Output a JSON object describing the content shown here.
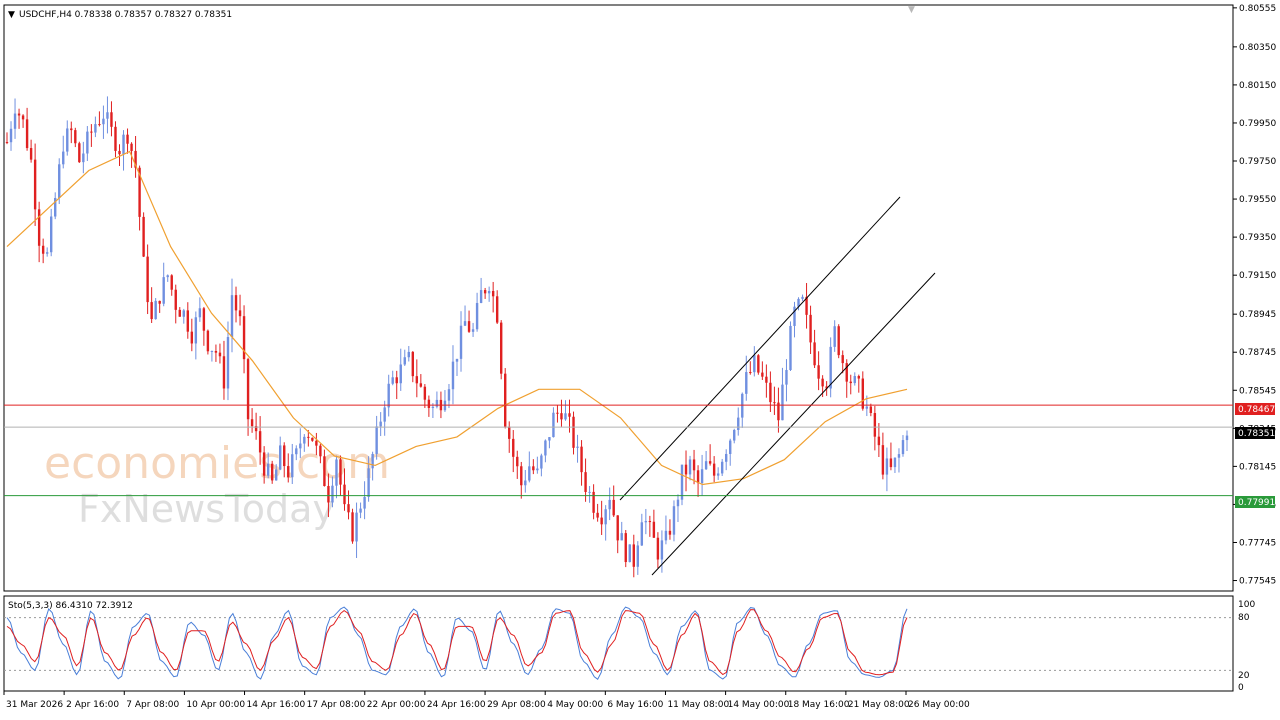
{
  "header": {
    "symbol_line": "USDCHF,H4  0.78338 0.78357 0.78327 0.78351"
  },
  "indicator": {
    "label": "Sto(5,3,3) 86.4310 72.3912",
    "levels": [
      "100",
      "80",
      "20",
      "0"
    ]
  },
  "watermark": {
    "line1": "economies.com",
    "line2": "FxNewsToday"
  },
  "price_labels": {
    "resistance": "0.78467",
    "current": "0.78351",
    "support": "0.77991"
  },
  "colors": {
    "bull": "#6f8fe0",
    "bear": "#e02020",
    "ma": "#f0a030",
    "resistance": "#e02020",
    "support": "#2a9a3a",
    "current_line": "#b0b0b0",
    "stoch_main": "#4a7fd8",
    "stoch_signal": "#e02020"
  },
  "chart_data": {
    "type": "candlestick",
    "instrument": "USDCHF",
    "timeframe": "H4",
    "ylim": [
      0.7749,
      0.8057
    ],
    "y_ticks": [
      "0.80555",
      "0.80350",
      "0.80150",
      "0.79950",
      "0.79750",
      "0.79550",
      "0.79350",
      "0.79150",
      "0.78945",
      "0.78745",
      "0.78545",
      "0.78345",
      "0.78145",
      "0.77945",
      "0.77745",
      "0.77545"
    ],
    "x_ticks": [
      "31 Mar 2026",
      "2 Apr 16:00",
      "7 Apr 08:00",
      "10 Apr 00:00",
      "14 Apr 16:00",
      "17 Apr 08:00",
      "22 Apr 00:00",
      "24 Apr 16:00",
      "29 Apr 08:00",
      "4 May 00:00",
      "6 May 16:00",
      "11 May 08:00",
      "14 May 00:00",
      "18 May 16:00",
      "21 May 08:00",
      "26 May 00:00"
    ],
    "series": [
      {
        "name": "price_path",
        "values": [
          0.7985,
          0.8005,
          0.7995,
          0.7975,
          0.7935,
          0.7925,
          0.7955,
          0.7985,
          0.799,
          0.7975,
          0.7985,
          0.7995,
          0.8,
          0.799,
          0.7982,
          0.799,
          0.7972,
          0.792,
          0.789,
          0.7905,
          0.7915,
          0.79,
          0.7895,
          0.7885,
          0.7895,
          0.788,
          0.7875,
          0.786,
          0.7905,
          0.789,
          0.784,
          0.783,
          0.7815,
          0.7805,
          0.782,
          0.7812,
          0.782,
          0.7835,
          0.783,
          0.7815,
          0.78,
          0.782,
          0.779,
          0.778,
          0.7795,
          0.781,
          0.783,
          0.785,
          0.786,
          0.7865,
          0.787,
          0.786,
          0.785,
          0.7845,
          0.785,
          0.786,
          0.7875,
          0.789,
          0.7885,
          0.7905,
          0.7912,
          0.7895,
          0.784,
          0.782,
          0.7805,
          0.7815,
          0.781,
          0.7825,
          0.784,
          0.7845,
          0.7835,
          0.782,
          0.7805,
          0.7795,
          0.779,
          0.78,
          0.778,
          0.777,
          0.7765,
          0.779,
          0.778,
          0.777,
          0.7775,
          0.779,
          0.781,
          0.7815,
          0.7805,
          0.7815,
          0.781,
          0.782,
          0.783,
          0.7845,
          0.786,
          0.7868,
          0.786,
          0.785,
          0.784,
          0.787,
          0.7895,
          0.79,
          0.788,
          0.7865,
          0.786,
          0.7885,
          0.787,
          0.786,
          0.7855,
          0.7845,
          0.783,
          0.7815,
          0.7812,
          0.782,
          0.7835
        ]
      },
      {
        "name": "moving_average",
        "values": [
          0.793,
          0.795,
          0.797,
          0.798,
          0.793,
          0.7895,
          0.787,
          0.784,
          0.782,
          0.7815,
          0.7825,
          0.783,
          0.7845,
          0.7855,
          0.7855,
          0.784,
          0.7815,
          0.7805,
          0.7808,
          0.7818,
          0.7838,
          0.785,
          0.7855
        ]
      },
      {
        "name": "stochastic_main",
        "values": [
          80,
          40,
          20,
          90,
          50,
          15,
          88,
          30,
          10,
          70,
          85,
          30,
          12,
          75,
          60,
          20,
          85,
          40,
          10,
          60,
          88,
          25,
          15,
          80,
          92,
          60,
          20,
          15,
          70,
          90,
          40,
          12,
          80,
          65,
          20,
          88,
          50,
          15,
          45,
          90,
          85,
          30,
          10,
          60,
          92,
          80,
          40,
          15,
          70,
          88,
          20,
          10,
          75,
          92,
          60,
          25,
          12,
          50,
          85,
          88,
          30,
          15,
          12,
          20,
          90
        ]
      },
      {
        "name": "stochastic_signal",
        "values": [
          70,
          50,
          30,
          80,
          60,
          25,
          80,
          40,
          20,
          60,
          80,
          40,
          20,
          65,
          65,
          30,
          75,
          50,
          20,
          55,
          80,
          35,
          22,
          70,
          88,
          65,
          30,
          20,
          60,
          85,
          50,
          20,
          70,
          70,
          30,
          80,
          60,
          25,
          40,
          85,
          88,
          40,
          18,
          50,
          88,
          85,
          50,
          20,
          60,
          85,
          30,
          15,
          65,
          90,
          65,
          35,
          18,
          45,
          80,
          85,
          40,
          18,
          15,
          18,
          80
        ]
      }
    ],
    "levels": {
      "resistance": 0.78467,
      "current": 0.78351,
      "support": 0.77991
    }
  }
}
